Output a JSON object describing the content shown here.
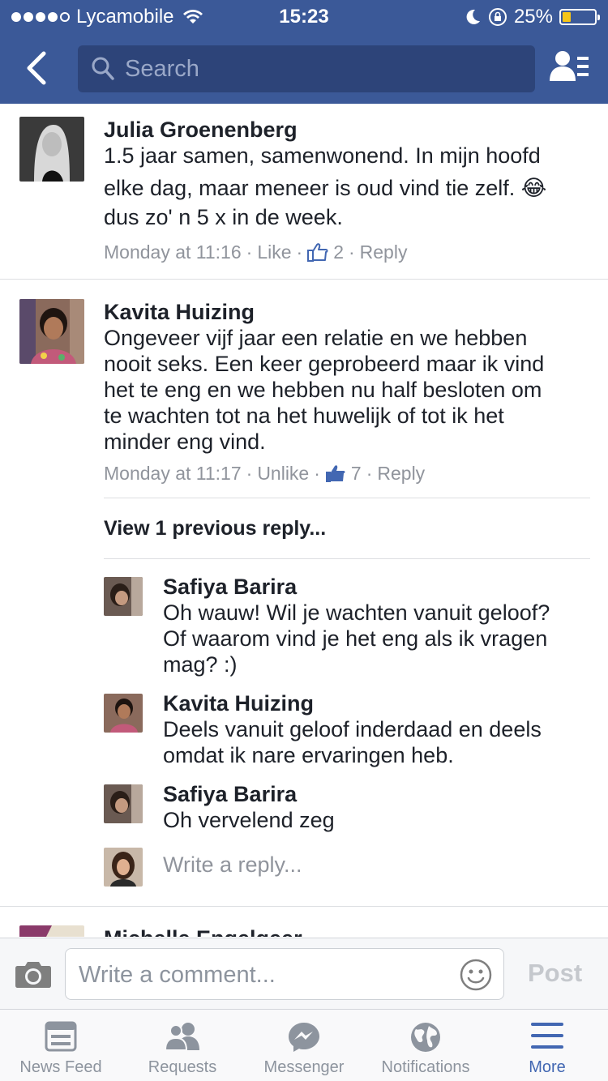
{
  "status_bar": {
    "carrier": "Lycamobile",
    "time": "15:23",
    "battery": "25%",
    "battery_level": 0.25
  },
  "nav": {
    "search_placeholder": "Search"
  },
  "comments": [
    {
      "author": "Julia Groenenberg",
      "text_lines": [
        "1.5 jaar samen, samenwonend. In mijn hoofd",
        "elke dag, maar meneer  is oud vind tie zelf. 😂",
        "dus zo' n 5 x in de week."
      ],
      "time": "Monday at 11:16",
      "like_label": "Like",
      "likes": "2",
      "reply_label": "Reply"
    },
    {
      "author": "Kavita Huizing",
      "text_lines": [
        "Ongeveer vijf jaar een relatie en we hebben",
        "nooit seks. Een keer geprobeerd maar ik vind",
        "het te eng en we hebben nu half besloten om",
        "te wachten tot na het huwelijk of tot ik het",
        "minder eng vind."
      ],
      "time": "Monday at 11:17",
      "like_label": "Unlike",
      "likes": "7",
      "reply_label": "Reply",
      "view_previous": "View 1 previous reply...",
      "replies": [
        {
          "author": "Safiya Barira",
          "text_lines": [
            "Oh wauw! Wil je wachten vanuit geloof?",
            "Of waarom vind je het eng als ik vragen",
            "mag? :)"
          ]
        },
        {
          "author": "Kavita Huizing",
          "text_lines": [
            "Deels vanuit geloof inderdaad en deels",
            "omdat ik nare ervaringen heb."
          ]
        },
        {
          "author": "Safiya Barira",
          "text_lines": [
            "Oh vervelend zeg"
          ]
        }
      ],
      "write_reply_placeholder": "Write a reply..."
    },
    {
      "author": "Michelle Engelgeer"
    }
  ],
  "composer": {
    "placeholder": "Write a comment...",
    "post_label": "Post"
  },
  "tabs": [
    {
      "label": "News Feed",
      "icon": "news-feed-icon"
    },
    {
      "label": "Requests",
      "icon": "requests-icon"
    },
    {
      "label": "Messenger",
      "icon": "messenger-icon"
    },
    {
      "label": "Notifications",
      "icon": "notifications-icon"
    },
    {
      "label": "More",
      "icon": "more-icon",
      "active": true
    }
  ],
  "colors": {
    "brand": "#3b5998",
    "link_active": "#4267b2",
    "meta_grey": "#90949c"
  }
}
